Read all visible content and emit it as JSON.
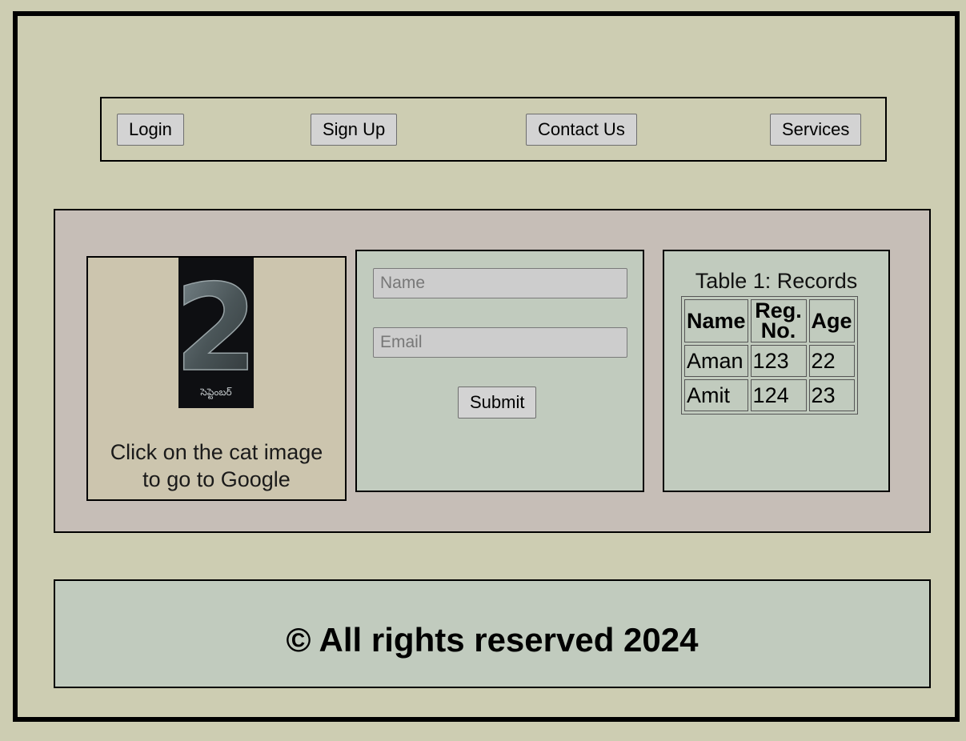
{
  "nav": {
    "login": "Login",
    "signup": "Sign Up",
    "contact": "Contact Us",
    "services": "Services"
  },
  "image_card": {
    "poster_big_text": "2",
    "poster_small_text": "సెప్టెంబర్",
    "caption_line1": "Click on the cat image",
    "caption_line2": "to go to Google"
  },
  "form": {
    "name_placeholder": "Name",
    "email_placeholder": "Email",
    "name_value": "",
    "email_value": "",
    "submit_label": "Submit"
  },
  "table": {
    "caption": "Table 1: Records",
    "headers": [
      "Name",
      "Reg. No.",
      "Age"
    ],
    "rows": [
      [
        "Aman",
        "123",
        "22"
      ],
      [
        "Amit",
        "124",
        "23"
      ]
    ]
  },
  "footer": {
    "text": "© All rights reserved 2024"
  },
  "colors": {
    "page_bg": "#cdcdb2",
    "main_bg": "#c6beb7",
    "card_bg": "#c1cbbe",
    "image_card_bg": "#ccc5ae"
  }
}
